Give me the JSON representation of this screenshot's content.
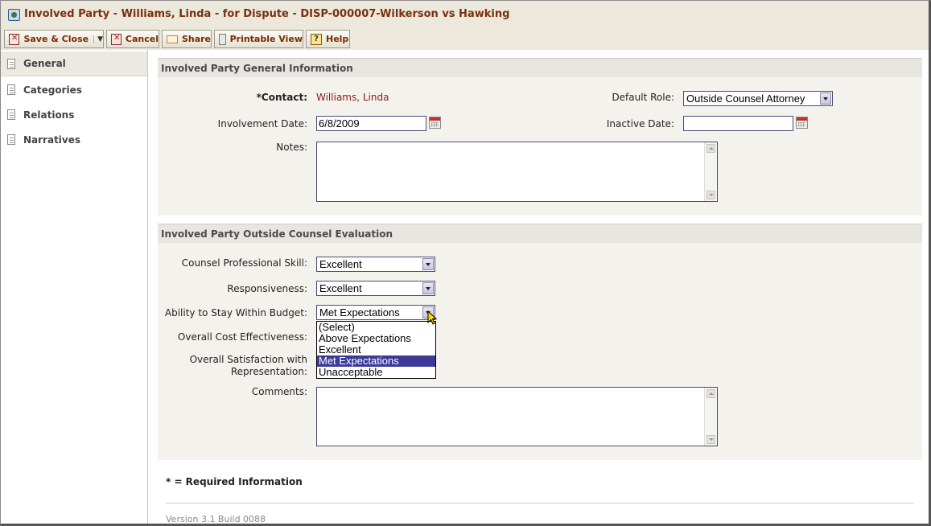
{
  "window": {
    "title": "Involved Party - Williams, Linda - for Dispute - DISP-000007-Wilkerson vs Hawking",
    "icon": "app-card-icon"
  },
  "toolbar": {
    "save_close": "Save & Close",
    "cancel": "Cancel",
    "share": "Share",
    "printable_view": "Printable View",
    "help": "Help"
  },
  "sidebar": {
    "items": [
      {
        "label": "General",
        "active": true
      },
      {
        "label": "Categories",
        "active": false
      },
      {
        "label": "Relations",
        "active": false
      },
      {
        "label": "Narratives",
        "active": false
      }
    ]
  },
  "general_info": {
    "header": "Involved Party General Information",
    "contact_label": "*Contact:",
    "contact_value": "Williams, Linda",
    "default_role_label": "Default Role:",
    "default_role_value": "Outside Counsel Attorney",
    "involvement_date_label": "Involvement Date:",
    "involvement_date_value": "6/8/2009",
    "inactive_date_label": "Inactive Date:",
    "inactive_date_value": "",
    "notes_label": "Notes:",
    "notes_value": ""
  },
  "evaluation": {
    "header": "Involved Party Outside Counsel Evaluation",
    "professional_skill_label": "Counsel Professional Skill:",
    "professional_skill_value": "Excellent",
    "responsiveness_label": "Responsiveness:",
    "responsiveness_value": "Excellent",
    "budget_label": "Ability to Stay Within Budget:",
    "budget_value": "Met Expectations",
    "cost_effectiveness_label": "Overall Cost Effectiveness:",
    "satisfaction_label_line1": "Overall Satisfaction with",
    "satisfaction_label_line2": "Representation:",
    "comments_label": "Comments:",
    "comments_value": "",
    "dropdown_options": [
      "(Select)",
      "Above Expectations",
      "Excellent",
      "Met Expectations",
      "Unacceptable"
    ],
    "dropdown_selected_index": 3
  },
  "footer": {
    "required_note": "* = Required Information",
    "version": "Version 3.1 Build 0088"
  },
  "colors": {
    "title_text": "#7a3010",
    "link_text": "#8a1a1a",
    "selection": "#3c3a98",
    "chrome": "#ece8dc"
  }
}
